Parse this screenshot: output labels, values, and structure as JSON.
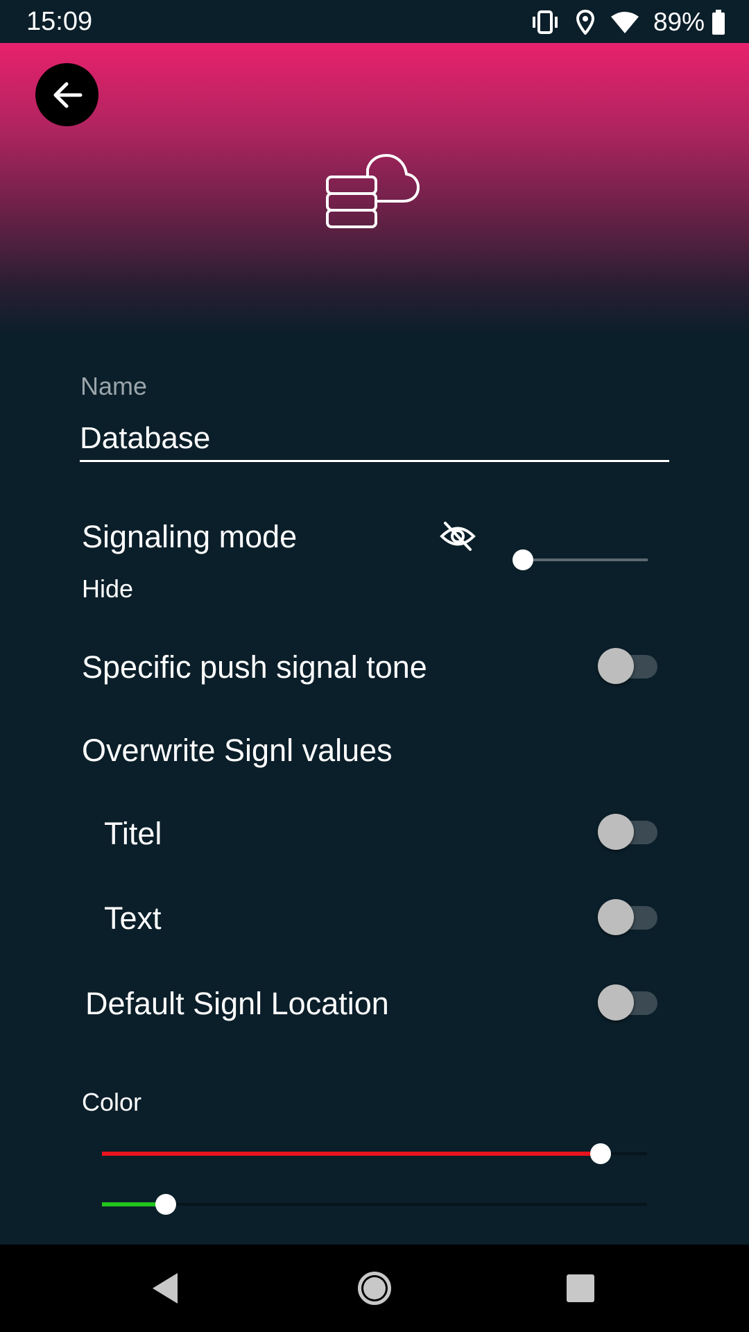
{
  "status_bar": {
    "time": "15:09",
    "battery_percent": "89%",
    "icons": [
      "vibrate-icon",
      "location-icon",
      "wifi-icon",
      "battery-icon"
    ]
  },
  "header": {
    "back_icon": "arrow-left-icon",
    "main_icon": "database-cloud-icon",
    "gradient_colors": [
      "#e8216d",
      "#0b1f2a"
    ]
  },
  "form": {
    "name_label": "Name",
    "name_value": "Database",
    "signaling_mode": {
      "label": "Signaling mode",
      "value": "Hide",
      "icon": "eye-off-icon",
      "slider_position": 0
    },
    "specific_push_tone": {
      "label": "Specific push signal tone",
      "enabled": false
    },
    "overwrite_section_label": "Overwrite Signl values",
    "titel": {
      "label": "Titel",
      "enabled": false
    },
    "text": {
      "label": "Text",
      "enabled": false
    },
    "default_location": {
      "label": "Default Signl Location",
      "enabled": false
    },
    "color": {
      "label": "Color",
      "red_fraction": 0.915,
      "green_fraction": 0.117,
      "red_color": "#e8141e",
      "green_color": "#22c41e"
    }
  },
  "nav_bar": {
    "buttons": [
      "back-triangle-icon",
      "home-circle-icon",
      "recents-square-icon"
    ]
  }
}
